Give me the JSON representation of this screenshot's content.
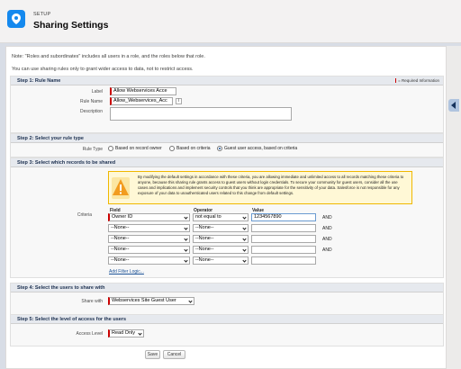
{
  "header": {
    "breadcrumb": "SETUP",
    "title": "Sharing Settings"
  },
  "notes": {
    "line1": "Note: \"Roles and subordinates\" includes all users in a role, and the roles below that role.",
    "line2": "You can use sharing rules only to grant wider access to data, not to restrict access."
  },
  "step1": {
    "title": "Step 1: Rule Name",
    "required_info": "= Required Information",
    "label_label": "Label",
    "label_value": "Allow Webservices Acce",
    "rule_name_label": "Rule Name",
    "rule_name_value": "Allow_Webservices_Acc",
    "rule_name_info": "i",
    "description_label": "Description",
    "description_value": ""
  },
  "step2": {
    "title": "Step 2: Select your rule type",
    "rule_type_label": "Rule Type",
    "options": [
      "Based on record owner",
      "Based on criteria",
      "Guest user access, based on criteria"
    ],
    "selected_index": 2
  },
  "step3": {
    "title": "Step 3: Select which records to be shared",
    "warning": "By modifying the default settings in accordance with these criteria, you are allowing immediate and unlimited access to all records matching these criteria to anyone, because this sharing rule grants access to guest users without login credentials. To secure your community for guest users, consider all the use cases and implications and implement security controls that you think are appropriate for the sensitivity of your data. Salesforce is not responsible for any exposure of your data to unauthenticated users related to this change from default settings.",
    "criteria_label": "Criteria",
    "col_field": "Field",
    "col_operator": "Operator",
    "col_value": "Value",
    "rows": [
      {
        "field": "Owner ID",
        "operator": "not equal to",
        "value": "1234567890",
        "and": "AND"
      },
      {
        "field": "--None--",
        "operator": "--None--",
        "value": "",
        "and": "AND"
      },
      {
        "field": "--None--",
        "operator": "--None--",
        "value": "",
        "and": "AND"
      },
      {
        "field": "--None--",
        "operator": "--None--",
        "value": "",
        "and": "AND"
      },
      {
        "field": "--None--",
        "operator": "--None--",
        "value": "",
        "and": ""
      }
    ],
    "add_filter_logic": "Add Filter Logic..."
  },
  "step4": {
    "title": "Step 4: Select the users to share with",
    "share_with_label": "Share with",
    "share_with_value": "Webservices Site Guest User"
  },
  "step5": {
    "title": "Step 5: Select the level of access for the users",
    "access_level_label": "Access Level",
    "access_level_value": "Read Only"
  },
  "actions": {
    "save": "Save",
    "cancel": "Cancel"
  },
  "colors": {
    "brand": "#1589ee",
    "required": "#cc0000",
    "warning_bg": "#fff8d6",
    "warning_icon": "#f29c1f"
  }
}
